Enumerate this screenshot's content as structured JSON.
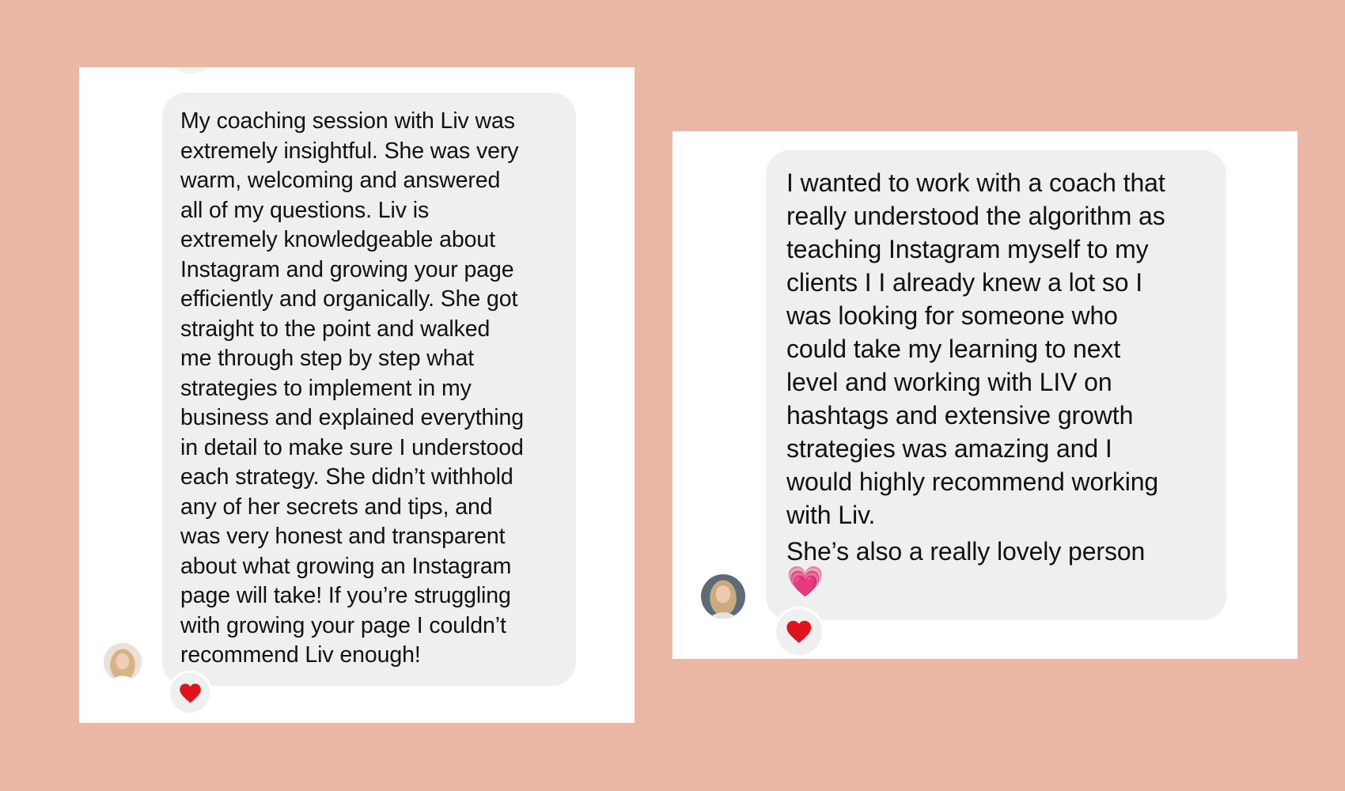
{
  "colors": {
    "background": "#eab8a5",
    "panel": "#ffffff",
    "bubble": "#efefef",
    "text": "#111111",
    "heart": "#e0141e"
  },
  "left_message": {
    "text": "My coaching session with Liv was\nextremely insightful. She was very\nwarm, welcoming and answered\nall of my questions. Liv is\nextremely knowledgeable about\nInstagram and growing your page\nefficiently and organically. She got\nstraight to the point and walked\nme through step by step what\nstrategies to implement in my\nbusiness and explained everything\nin detail to make sure I understood\neach strategy.  She didn’t withhold\nany of her secrets and tips, and\nwas very honest and transparent\nabout what growing an Instagram\npage will take! If you’re struggling\nwith growing your page I couldn’t\nrecommend Liv enough!",
    "reaction": "heart-icon",
    "avatar": "avatar"
  },
  "right_message": {
    "text": "I wanted to work with a coach that\nreally understood the algorithm as\nteaching Instagram myself to my\nclients I I already knew a lot so I\nwas looking for someone who\ncould take my learning to next\nlevel and working with LIV on\nhashtags and extensive growth\nstrategies was amazing and I\nwould highly recommend working\nwith Liv.",
    "text_2": "She’s also a really lovely person",
    "emoji": "💗",
    "reaction": "heart-icon",
    "avatar": "avatar"
  }
}
